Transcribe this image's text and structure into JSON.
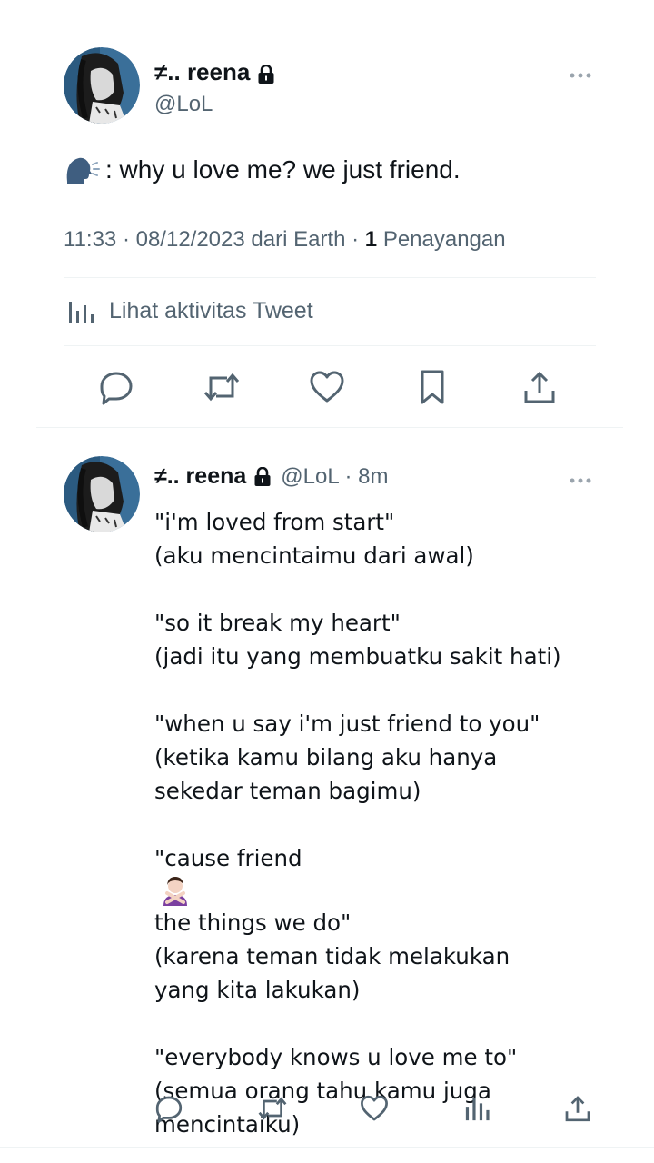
{
  "main_tweet": {
    "display_name": "≠.. reena",
    "handle": "@LoL",
    "text": ": why u love me? we just friend.",
    "timestamp": "11:33 · 08/12/2023 dari Earth ·",
    "views_count": "1",
    "views_label": "Penayangan",
    "activity_label": "Lihat aktivitas Tweet",
    "icons": {
      "lock": "lock-icon",
      "more": "more-icon",
      "speaking": "speaking-head-emoji",
      "activity": "analytics-icon"
    }
  },
  "main_actions": [
    {
      "name": "reply",
      "icon": "reply-icon"
    },
    {
      "name": "retweet",
      "icon": "retweet-icon"
    },
    {
      "name": "like",
      "icon": "heart-icon"
    },
    {
      "name": "bookmark",
      "icon": "bookmark-icon"
    },
    {
      "name": "share",
      "icon": "share-icon"
    }
  ],
  "reply": {
    "display_name": "≠.. reena",
    "meta": "@LoL · 8m",
    "stanzas": [
      [
        "\"i'm loved from start\"",
        "(aku mencintaimu dari awal)"
      ],
      [
        "\"so it break my heart\"",
        "(jadi itu yang membuatku sakit hati)"
      ],
      [
        "\"when u say i'm just friend to you\"",
        "(ketika kamu bilang aku hanya",
        "sekedar teman bagimu)"
      ],
      [
        "\"cause friend",
        "the things we do\"",
        "(karena teman tidak melakukan",
        "yang kita lakukan)"
      ],
      [
        "\"everybody knows u love me to\"",
        "(semua orang tahu kamu juga",
        "mencintaiku)"
      ]
    ],
    "inline_emoji": "person-gesturing-no-emoji"
  },
  "reply_actions": [
    {
      "name": "reply",
      "icon": "reply-icon"
    },
    {
      "name": "retweet",
      "icon": "retweet-icon"
    },
    {
      "name": "like",
      "icon": "heart-icon"
    },
    {
      "name": "views",
      "icon": "analytics-icon"
    },
    {
      "name": "share",
      "icon": "share-icon"
    }
  ],
  "colors": {
    "text": "#0f1419",
    "secondary": "#536471",
    "divider": "#eff3f4"
  }
}
